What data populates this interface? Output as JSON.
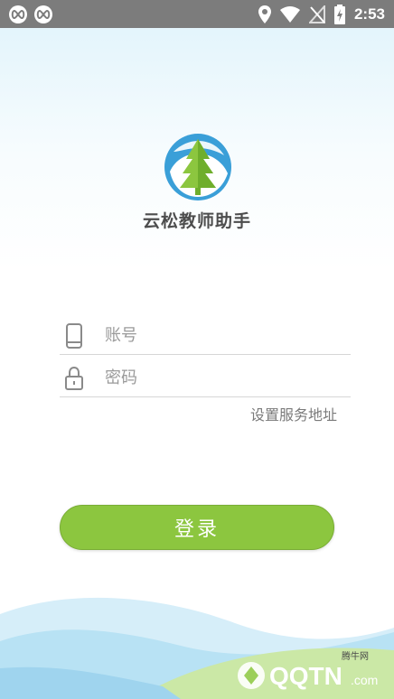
{
  "status_bar": {
    "time": "2:53",
    "icons": [
      "infinity-icon",
      "infinity-icon",
      "location-icon",
      "wifi-icon",
      "no-sim-icon",
      "battery-charging-icon"
    ]
  },
  "app": {
    "title": "云松教师助手",
    "brand_color": "#3a9fd8",
    "tree_color": "#8cc63f"
  },
  "form": {
    "account_placeholder": "账号",
    "password_placeholder": "密码",
    "server_link": "设置服务地址",
    "login_label": "登录"
  },
  "watermark": {
    "top_text": "腾牛网",
    "brand_text": "QQTN",
    "domain_text": ".com"
  }
}
